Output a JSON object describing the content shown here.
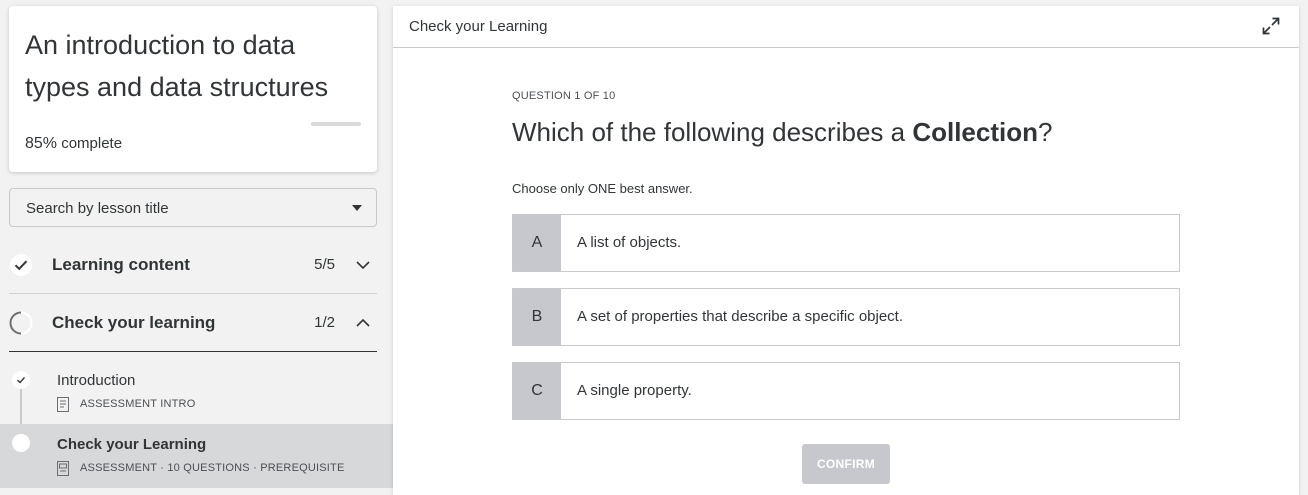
{
  "course": {
    "title": "An introduction to data types and data structures",
    "progress_percent": "85%",
    "progress_value": 0.85,
    "complete_label": "complete"
  },
  "search": {
    "label": "Search by lesson title"
  },
  "sections": [
    {
      "title": "Learning content",
      "count": "5/5",
      "status": "complete",
      "expanded": false
    },
    {
      "title": "Check your learning",
      "count": "1/2",
      "status": "in-progress",
      "expanded": true
    }
  ],
  "lessons": [
    {
      "title": "Introduction",
      "meta": "ASSESSMENT INTRO",
      "status": "complete",
      "active": false
    },
    {
      "title": "Check your Learning",
      "meta": "ASSESSMENT · 10 QUESTIONS · PREREQUISITE",
      "status": "current",
      "active": true
    }
  ],
  "main": {
    "header_title": "Check your Learning",
    "question_counter": "QUESTION 1 OF 10",
    "question_prefix": "Which of the following describes a ",
    "question_bold": "Collection",
    "question_suffix": "?",
    "instruction": "Choose only ONE best answer.",
    "options": [
      {
        "letter": "A",
        "text": "A list of objects."
      },
      {
        "letter": "B",
        "text": "A set of properties that describe a specific object."
      },
      {
        "letter": "C",
        "text": "A single property."
      }
    ],
    "confirm_label": "CONFIRM"
  },
  "colors": {
    "text": "#313537",
    "option_letter_bg": "#c6c8cd",
    "active_lesson_bg": "#d7d8da",
    "confirm_disabled_bg": "#c6c8cd"
  }
}
